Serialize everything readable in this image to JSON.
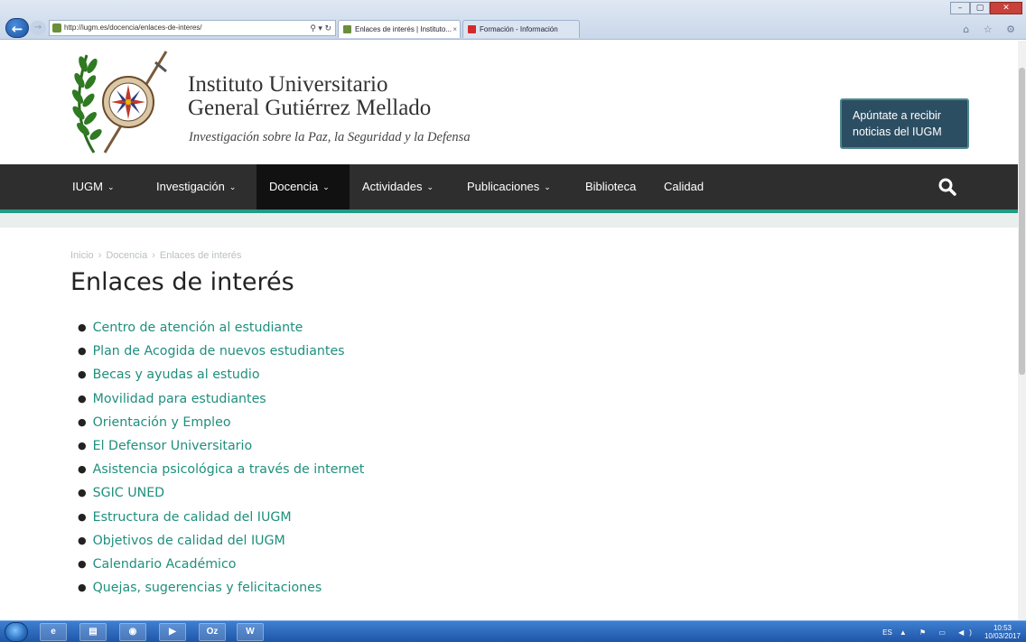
{
  "browser": {
    "url": "http://iugm.es/docencia/enlaces-de-interes/",
    "address_tools": "⚲ ▾ ↻",
    "tabs": [
      {
        "label": "Enlaces de interés | Instituto...",
        "close": "×"
      },
      {
        "label": "Formación - Información Curs..."
      }
    ],
    "window_controls": [
      "–",
      "▢",
      "✕"
    ],
    "toolbar_icons": "⌂ ☆ ⚙"
  },
  "header": {
    "title_line1": "Instituto Universitario",
    "title_line2": "General Gutiérrez Mellado",
    "tagline": "Investigación sobre la Paz, la Seguridad y la Defensa",
    "subscribe_label": "Apúntate a recibir noticias del IUGM"
  },
  "nav": {
    "items": [
      {
        "label": "IUGM",
        "dropdown": true
      },
      {
        "label": "Investigación",
        "dropdown": true
      },
      {
        "label": "Docencia",
        "dropdown": true,
        "active": true
      },
      {
        "label": "Actividades",
        "dropdown": true
      },
      {
        "label": "Publicaciones",
        "dropdown": true
      },
      {
        "label": "Biblioteca",
        "dropdown": false
      },
      {
        "label": "Calidad",
        "dropdown": false
      }
    ],
    "chevron": "⌄"
  },
  "breadcrumb": {
    "items": [
      "Inicio",
      "Docencia",
      "Enlaces de interés"
    ],
    "separator": "›"
  },
  "page": {
    "title": "Enlaces de interés",
    "links": [
      "Centro de atención al estudiante",
      "Plan de Acogida de nuevos estudiantes",
      "Becas y ayudas al estudio",
      "Movilidad para estudiantes",
      "Orientación y Empleo",
      "El Defensor Universitario",
      "Asistencia psicológica a través de internet",
      "SGIC UNED",
      "Estructura de calidad del IUGM",
      "Objetivos de calidad del IUGM",
      "Calendario Académico",
      "Quejas, sugerencias y felicitaciones"
    ]
  },
  "taskbar": {
    "apps": [
      "e",
      "▤",
      "◉",
      "▶",
      "Oz",
      "W"
    ],
    "lang": "ES",
    "tray_icons": "▲ ⚑ ▭ ◀)",
    "time": "10:53",
    "date": "10/03/2017"
  },
  "colors": {
    "link": "#1f8f7d",
    "nav_bg": "#2e2e2e",
    "nav_active": "#111111",
    "accent": "#1f9c88",
    "subscribe_bg": "#2c4e63"
  }
}
